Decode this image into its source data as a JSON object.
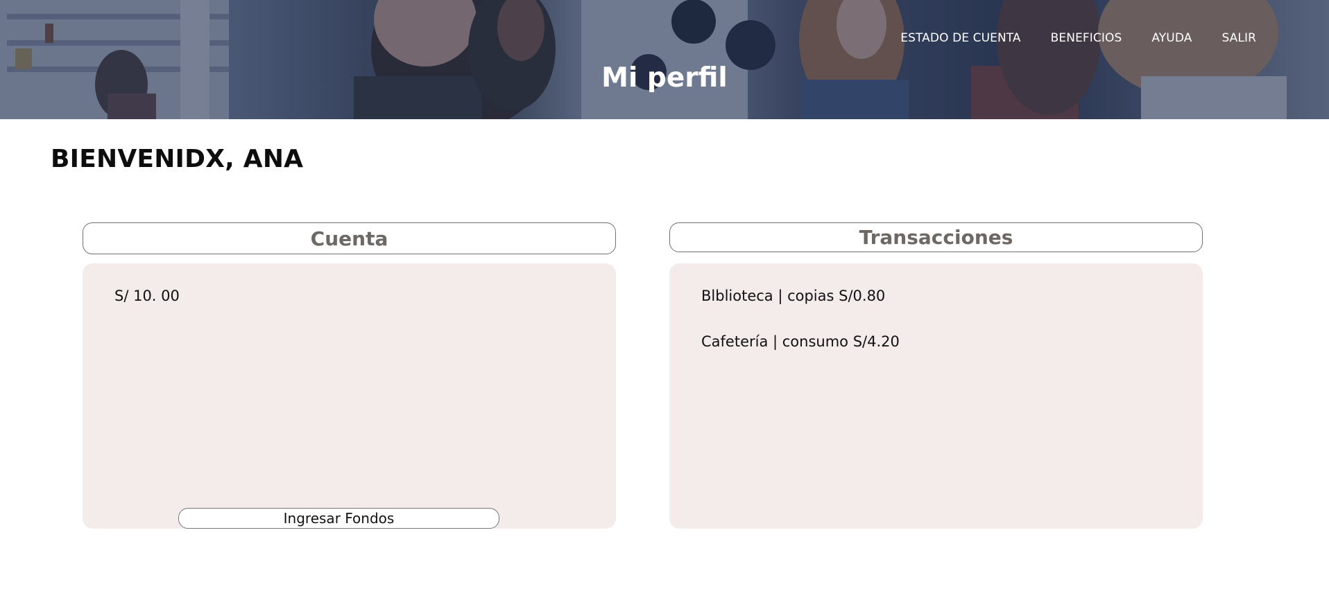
{
  "hero": {
    "title": "Mi perfil"
  },
  "nav": {
    "items": [
      "ESTADO DE CUENTA",
      "BENEFICIOS",
      "AYUDA",
      "SALIR"
    ]
  },
  "welcome": "BIENVENIDX, ANA",
  "account": {
    "header": "Cuenta",
    "balance": "S/ 10. 00",
    "button_label": "Ingresar Fondos"
  },
  "transactions": {
    "header": "Transacciones",
    "items": [
      "Blblioteca | copias S/0.80",
      "Cafetería | consumo S/4.20"
    ]
  }
}
